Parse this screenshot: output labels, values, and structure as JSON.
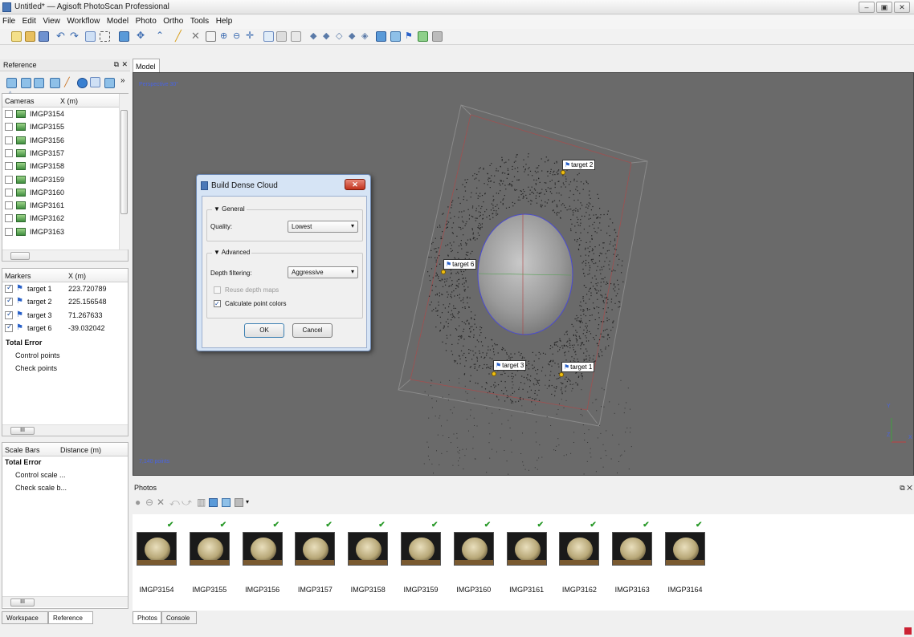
{
  "window": {
    "title": "Untitled* — Agisoft PhotoScan Professional"
  },
  "menu": [
    "File",
    "Edit",
    "View",
    "Workflow",
    "Model",
    "Photo",
    "Ortho",
    "Tools",
    "Help"
  ],
  "reference_panel": {
    "title": "Reference",
    "cameras": {
      "col1": "Cameras",
      "col2": "X (m)",
      "items": [
        "IMGP3154",
        "IMGP3155",
        "IMGP3156",
        "IMGP3157",
        "IMGP3158",
        "IMGP3159",
        "IMGP3160",
        "IMGP3161",
        "IMGP3162",
        "IMGP3163"
      ]
    },
    "markers": {
      "col1": "Markers",
      "col2": "X (m)",
      "items": [
        {
          "label": "target 1",
          "x": "223.720789"
        },
        {
          "label": "target 2",
          "x": "225.156548"
        },
        {
          "label": "target 3",
          "x": "71.267633"
        },
        {
          "label": "target 6",
          "x": "-39.032042"
        }
      ],
      "total_error": "Total Error",
      "control_points": "Control points",
      "check_points": "Check points"
    },
    "scalebars": {
      "col1": "Scale Bars",
      "col2": "Distance (m)",
      "total_error": "Total Error",
      "control": "Control scale ...",
      "check": "Check scale b..."
    },
    "scroll_label": "III",
    "tabs": [
      "Workspace",
      "Reference"
    ]
  },
  "model": {
    "tab": "Model",
    "projection": "Perspective 30°",
    "points": "7,140 points",
    "targets": [
      "target 2",
      "target 6",
      "target 3",
      "target 1"
    ],
    "axes": {
      "y": "Y",
      "z": "Z",
      "x": "X"
    }
  },
  "dialog": {
    "title": "Build Dense Cloud",
    "general": "General",
    "quality_label": "Quality:",
    "quality_value": "Lowest",
    "advanced": "Advanced",
    "depth_label": "Depth filtering:",
    "depth_value": "Aggressive",
    "reuse": "Reuse depth maps",
    "calc_colors": "Calculate point colors",
    "ok": "OK",
    "cancel": "Cancel"
  },
  "photos": {
    "title": "Photos",
    "items": [
      "IMGP3154",
      "IMGP3155",
      "IMGP3156",
      "IMGP3157",
      "IMGP3158",
      "IMGP3159",
      "IMGP3160",
      "IMGP3161",
      "IMGP3162",
      "IMGP3163",
      "IMGP3164"
    ],
    "tabs": [
      "Photos",
      "Console"
    ]
  }
}
